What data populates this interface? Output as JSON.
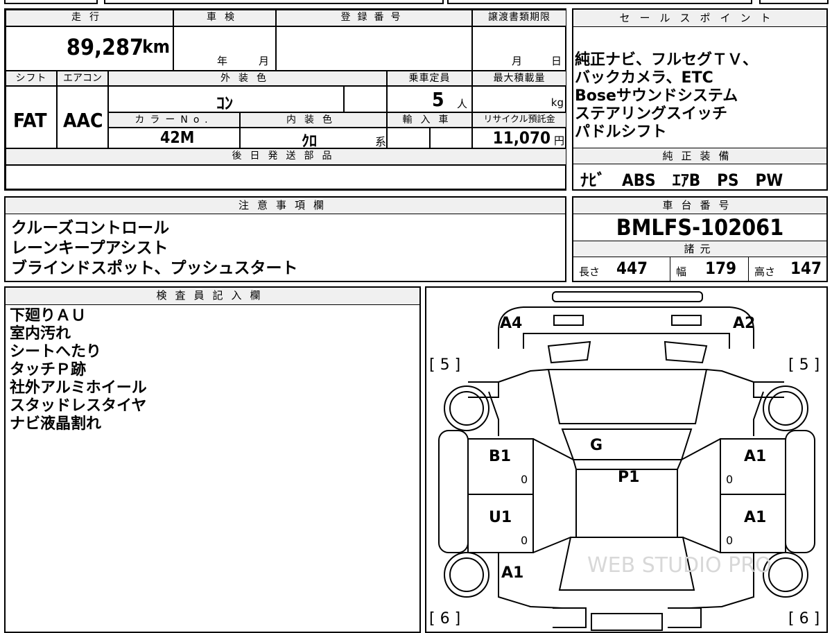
{
  "top_left": {
    "labels": {
      "mileage": "走行",
      "inspection": "車検",
      "registration_no": "登録番号",
      "doc_deadline": "譲渡書類期限",
      "shift": "シフト",
      "aircon": "エアコン",
      "exterior_color": "外装色",
      "capacity": "乗車定員",
      "max_load": "最大積載量",
      "color_no": "カラーNo.",
      "interior_color": "内装色",
      "import": "輸入車",
      "recycle": "リサイクル預託金",
      "later_parts": "後日発送部品"
    },
    "values": {
      "mileage": "89,287",
      "mileage_unit": "km",
      "inspection_year_unit": "年",
      "inspection_month_unit": "月",
      "deadline_month_unit": "月",
      "deadline_day_unit": "日",
      "shift": "FAT",
      "aircon": "AAC",
      "exterior_color": "ｺﾝ",
      "capacity": "5",
      "capacity_unit": "人",
      "max_load_unit": "kg",
      "color_no": "42M",
      "interior_color": "ｸﾛ",
      "interior_suffix": "系",
      "recycle": "11,070",
      "recycle_unit": "円"
    }
  },
  "sales_points": {
    "title": "セールスポイント",
    "lines": [
      "純正ナビ、フルセグＴＶ、",
      "バックカメラ、ETC",
      "Boseサウンドシステム",
      "ステアリングスイッチ",
      "パドルシフト"
    ],
    "equipment_title": "純正装備",
    "equipment": "ﾅﾋﾞ　ABS　ｴｱB　PS　PW"
  },
  "notes": {
    "title": "注意事項欄",
    "lines": [
      "クルーズコントロール",
      "レーンキープアシスト",
      "ブラインドスポット、プッシュスタート"
    ]
  },
  "chassis": {
    "title": "車台番号",
    "number": "BMLFS-102061",
    "specs_title": "諸元",
    "length_label": "長さ",
    "length": "447",
    "width_label": "幅",
    "width": "179",
    "height_label": "高さ",
    "height": "147"
  },
  "inspector": {
    "title": "検査員記入欄",
    "lines": [
      "下廻りＡＵ",
      "室内汚れ",
      "シートへたり",
      "タッチＰ跡",
      "社外アルミホイール",
      "スタッドレスタイヤ",
      "ナビ液晶割れ"
    ]
  },
  "diagram": {
    "marks": {
      "a4": "A4",
      "a2": "A2",
      "g": "G",
      "p1": "P1",
      "b1": "B1",
      "a1_right_front": "A1",
      "u1": "U1",
      "a1_right_rear": "A1",
      "a1_left_rear": "A1",
      "tire_fl": "[ 5 ]",
      "tire_fr": "[ 5 ]",
      "tire_rl": "[ 6 ]",
      "tire_rr": "[ 6 ]",
      "zero": "0"
    },
    "watermark": "WEB STUDIO PRO"
  }
}
